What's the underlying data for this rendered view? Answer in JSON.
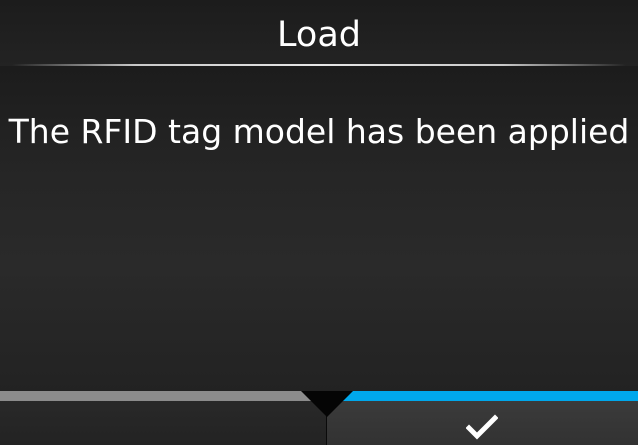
{
  "header": {
    "title": "Load"
  },
  "main": {
    "message": "The RFID tag model has been applied"
  },
  "footer": {
    "left_button": {
      "label": ""
    },
    "right_button": {
      "icon": "check-icon"
    }
  },
  "colors": {
    "background": "#1b1b1b",
    "text": "#ffffff",
    "accent": "#00a8ec",
    "inactive_strip": "#8c8c8c"
  }
}
